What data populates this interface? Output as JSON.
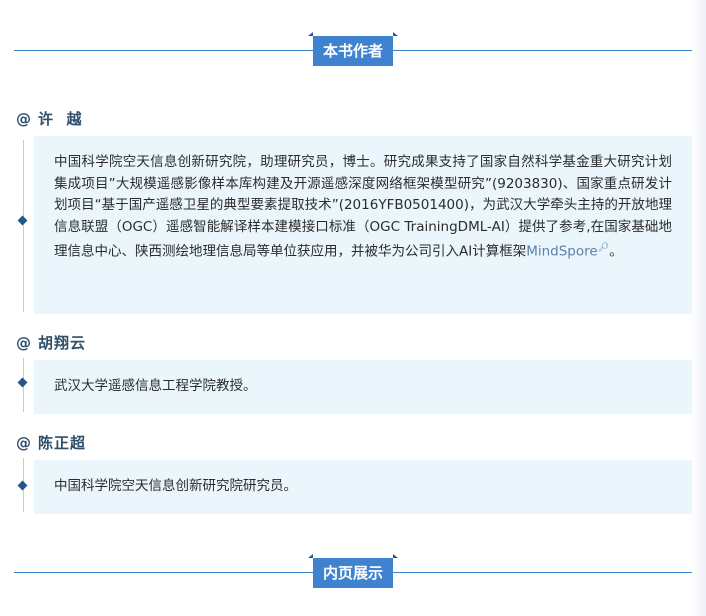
{
  "sections": {
    "top_title": "本书作者",
    "bottom_title": "内页展示"
  },
  "authors": [
    {
      "symbol": "@",
      "name": "许  越",
      "bio": "中国科学院空天信息创新研究院，助理研究员，博士。研究成果支持了国家自然科学基金重大研究计划集成项目”大规模遥感影像样本库构建及开源遥感深度网络框架模型研究”(9203830)、国家重点研发计划项目“基于国产遥感卫星的典型要素提取技术”(2016YFB0501400)，为武汉大学牵头主持的开放地理信息联盟（OGC）遥感智能解译样本建模接口标准（OGC TrainingDML-AI）提供了参考,在国家基础地理信息中心、陕西测绘地理信息局等单位获应用，并被华为公司引入AI计算框架",
      "link_text": "MindSpore",
      "link_icon": "search-icon",
      "bio_suffix": "。"
    },
    {
      "symbol": "@",
      "name": "胡翔云",
      "bio": "武汉大学遥感信息工程学院教授。"
    },
    {
      "symbol": "@",
      "name": "陈正超",
      "bio": "中国科学院空天信息创新研究院研究员。"
    }
  ],
  "colors": {
    "accent": "#3f82d0",
    "accent_dark": "#25578a",
    "box_bg": "#eaf6fb",
    "name_color": "#2f4f6a"
  }
}
